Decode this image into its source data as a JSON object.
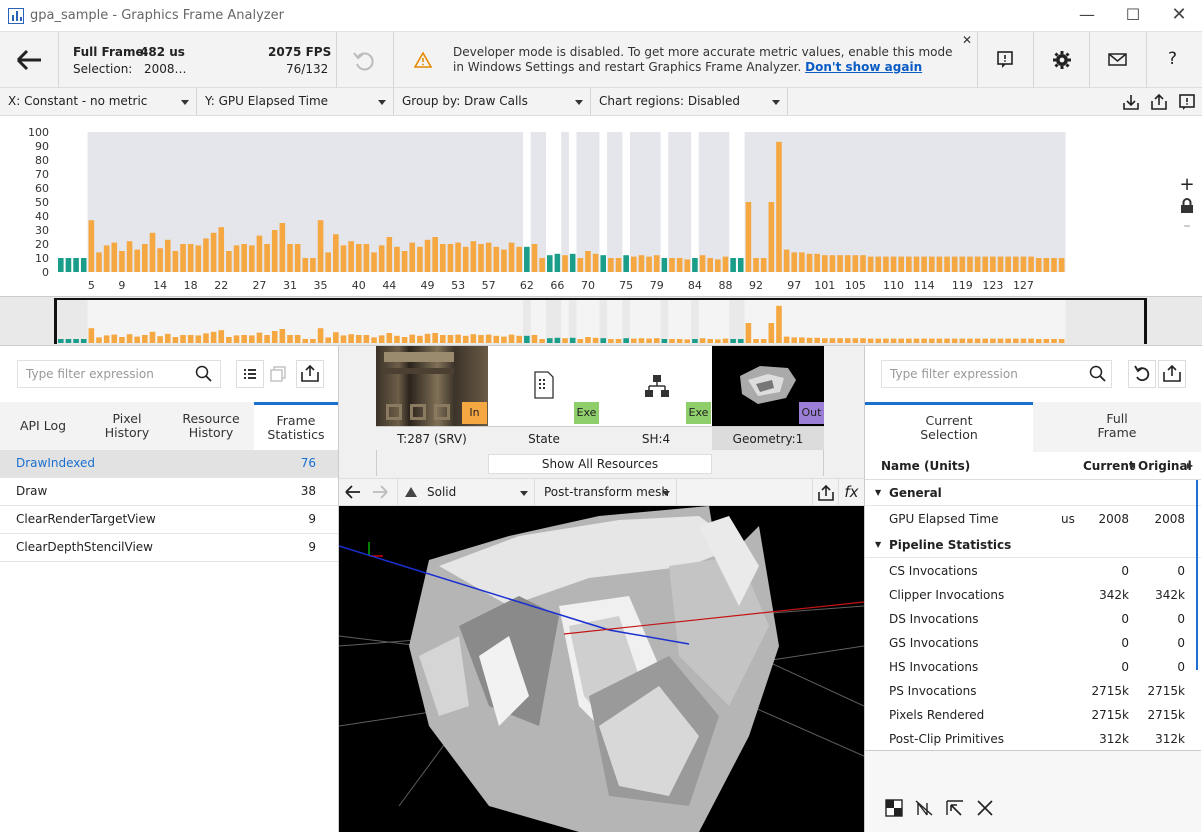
{
  "window": {
    "title": "gpa_sample - Graphics Frame Analyzer"
  },
  "toolbar": {
    "full_frame_label": "Full Frame:",
    "full_frame_value": "482 us",
    "selection_label": "Selection:",
    "selection_value": "2008…",
    "fps": "2075 FPS",
    "selection_count": "76/132",
    "notice_text": "Developer mode is disabled. To get more accurate metric values, enable this mode in Windows Settings and restart Graphics Frame Analyzer.",
    "notice_link": "Don't show again",
    "help_label": "?"
  },
  "controls": {
    "x_axis": "X: Constant - no metric",
    "y_axis": "Y: GPU Elapsed Time",
    "group_by": "Group by: Draw Calls",
    "chart_regions": "Chart regions: Disabled"
  },
  "chart_data": {
    "type": "bar",
    "ylim": [
      0,
      100
    ],
    "yticks": [
      "100",
      "90",
      "80",
      "70",
      "60",
      "50",
      "40",
      "30",
      "20",
      "10",
      "0"
    ],
    "xticks": [
      "5",
      "9",
      "14",
      "18",
      "22",
      "27",
      "31",
      "35",
      "40",
      "44",
      "49",
      "53",
      "57",
      "62",
      "66",
      "70",
      "75",
      "79",
      "84",
      "88",
      "92",
      "97",
      "101",
      "105",
      "110",
      "114",
      "119",
      "123",
      "127"
    ],
    "series_colors": {
      "clear": "#1a9e8a",
      "selected": "#f5a742",
      "other": "#3b86e0",
      "region": "#e4e6ec"
    },
    "values": [
      10,
      10,
      10,
      10,
      37,
      14,
      19,
      21,
      15,
      22,
      16,
      20,
      28,
      17,
      23,
      15,
      20,
      20,
      19,
      24,
      28,
      32,
      15,
      19,
      20,
      19,
      26,
      20,
      30,
      35,
      20,
      20,
      10,
      10,
      37,
      14,
      27,
      19,
      22,
      20,
      20,
      14,
      19,
      25,
      18,
      15,
      21,
      18,
      23,
      25,
      20,
      20,
      21,
      18,
      22,
      20,
      21,
      18,
      16,
      21,
      18,
      18,
      20,
      10,
      12,
      13,
      12,
      13,
      10,
      15,
      13,
      12,
      10,
      10,
      12,
      11,
      12,
      11,
      12,
      10,
      10,
      10,
      9,
      10,
      12,
      10,
      9,
      11,
      10,
      10,
      50,
      10,
      10,
      50,
      93,
      16,
      14,
      14,
      13,
      13,
      12,
      12,
      12,
      12,
      12,
      12,
      11,
      11,
      11,
      11,
      11,
      11,
      11,
      11,
      11,
      11,
      11,
      11,
      11,
      11,
      11,
      11,
      11,
      11,
      11,
      11,
      11,
      11,
      10,
      10,
      10,
      10
    ],
    "kinds": "CCCCSSSSSSSSSSSSSSSSSSSSSSSSSSSSSSSSSSSSSSSSSSSSSSSSSSSSSSSSSCSSCCSCSSSCSSCSSSSCSSSCSSSSCCSSSSSSSSSSSSSSSSSSSSSSSSSSSSSSSSSSSSSSSSSSS",
    "zoom_in": "+",
    "zoom_out": "–"
  },
  "left": {
    "filter_placeholder": "Type filter expression",
    "tabs": [
      {
        "label": "API Log"
      },
      {
        "label": "Pixel History"
      },
      {
        "label": "Resource History"
      },
      {
        "label": "Frame Statistics"
      }
    ],
    "rows": [
      {
        "name": "DrawIndexed",
        "count": "76"
      },
      {
        "name": "Draw",
        "count": "38"
      },
      {
        "name": "ClearRenderTargetView",
        "count": "9"
      },
      {
        "name": "ClearDepthStencilView",
        "count": "9"
      }
    ]
  },
  "middle": {
    "resources": [
      {
        "label": "T:287 (SRV)",
        "tag": "In",
        "tag_color": "#f5a742"
      },
      {
        "label": "State",
        "tag": "Exe",
        "tag_color": "#8fcf6b"
      },
      {
        "label": "SH:4",
        "tag": "Exe",
        "tag_color": "#8fcf6b"
      },
      {
        "label": "Geometry:1",
        "tag": "Out",
        "tag_color": "#9b7fd6"
      }
    ],
    "show_all": "Show All Resources",
    "render_mode": "Solid",
    "mesh_mode": "Post-transform mesh",
    "fx_label": "fx"
  },
  "right": {
    "filter_placeholder": "Type filter expression",
    "tabs": [
      {
        "label": "Current Selection"
      },
      {
        "label": "Full Frame"
      }
    ],
    "header": {
      "name": "Name (Units)",
      "current": "Current",
      "original": "Original"
    },
    "sections": [
      {
        "title": "General",
        "rows": [
          {
            "name": "GPU Elapsed Time",
            "unit": "us",
            "current": "2008",
            "original": "2008"
          }
        ]
      },
      {
        "title": "Pipeline Statistics",
        "rows": [
          {
            "name": "CS Invocations",
            "unit": "",
            "current": "0",
            "original": "0"
          },
          {
            "name": "Clipper Invocations",
            "unit": "",
            "current": "342k",
            "original": "342k"
          },
          {
            "name": "DS Invocations",
            "unit": "",
            "current": "0",
            "original": "0"
          },
          {
            "name": "GS Invocations",
            "unit": "",
            "current": "0",
            "original": "0"
          },
          {
            "name": "HS Invocations",
            "unit": "",
            "current": "0",
            "original": "0"
          },
          {
            "name": "PS Invocations",
            "unit": "",
            "current": "2715k",
            "original": "2715k"
          },
          {
            "name": "Pixels Rendered",
            "unit": "",
            "current": "2715k",
            "original": "2715k"
          },
          {
            "name": "Post-Clip Primitives",
            "unit": "",
            "current": "312k",
            "original": "312k"
          }
        ]
      }
    ]
  }
}
